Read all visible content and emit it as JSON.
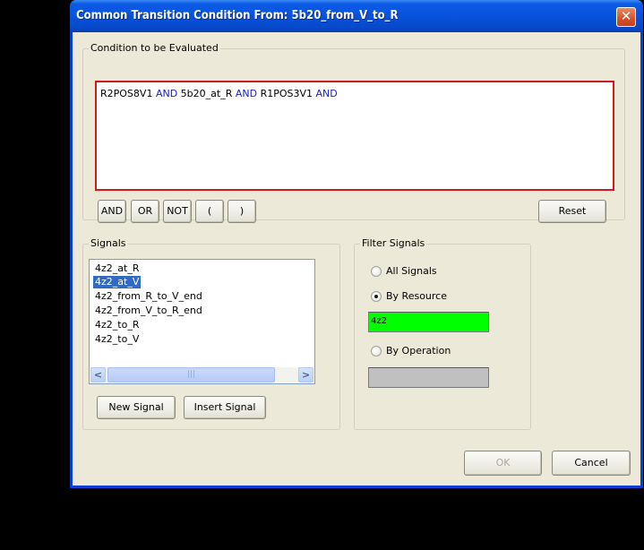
{
  "window": {
    "title": "Common Transition Condition From: 5b20_from_V_to_R",
    "close_glyph": "✕"
  },
  "condition": {
    "group_label": "Condition to be Evaluated",
    "tokens": [
      {
        "text": "R2POS8V1",
        "type": "signal"
      },
      {
        "text": "AND",
        "type": "operator"
      },
      {
        "text": "5b20_at_R",
        "type": "signal"
      },
      {
        "text": "AND",
        "type": "operator"
      },
      {
        "text": "R1POS3V1",
        "type": "signal"
      },
      {
        "text": "AND",
        "type": "operator"
      }
    ],
    "border_color": "#cc1b1b",
    "operator_color": "#1a1ad2",
    "buttons": {
      "and": "AND",
      "or": "OR",
      "not": "NOT",
      "open_paren": "(",
      "close_paren": ")",
      "reset": "Reset"
    }
  },
  "signals": {
    "group_label": "Signals",
    "items": [
      {
        "label": "4z2_at_R",
        "selected": false
      },
      {
        "label": "4z2_at_V",
        "selected": true
      },
      {
        "label": "4z2_from_R_to_V_end",
        "selected": false
      },
      {
        "label": "4z2_from_V_to_R_end",
        "selected": false
      },
      {
        "label": "4z2_to_R",
        "selected": false
      },
      {
        "label": "4z2_to_V",
        "selected": false
      }
    ],
    "scroll_left_glyph": "<",
    "scroll_right_glyph": ">",
    "scroll_thumb_grip": "|||",
    "new_signal_label": "New Signal",
    "insert_signal_label": "Insert Signal"
  },
  "filter": {
    "group_label": "Filter Signals",
    "options": [
      {
        "label": "All Signals",
        "checked": false
      },
      {
        "label": "By Resource",
        "checked": true
      },
      {
        "label": "By Operation",
        "checked": false
      }
    ],
    "resource_value": "4z2",
    "resource_bg": "#00ff00",
    "operation_value": "",
    "operation_bg": "#c0c0c0"
  },
  "footer": {
    "ok_label": "OK",
    "ok_enabled": false,
    "cancel_label": "Cancel"
  }
}
